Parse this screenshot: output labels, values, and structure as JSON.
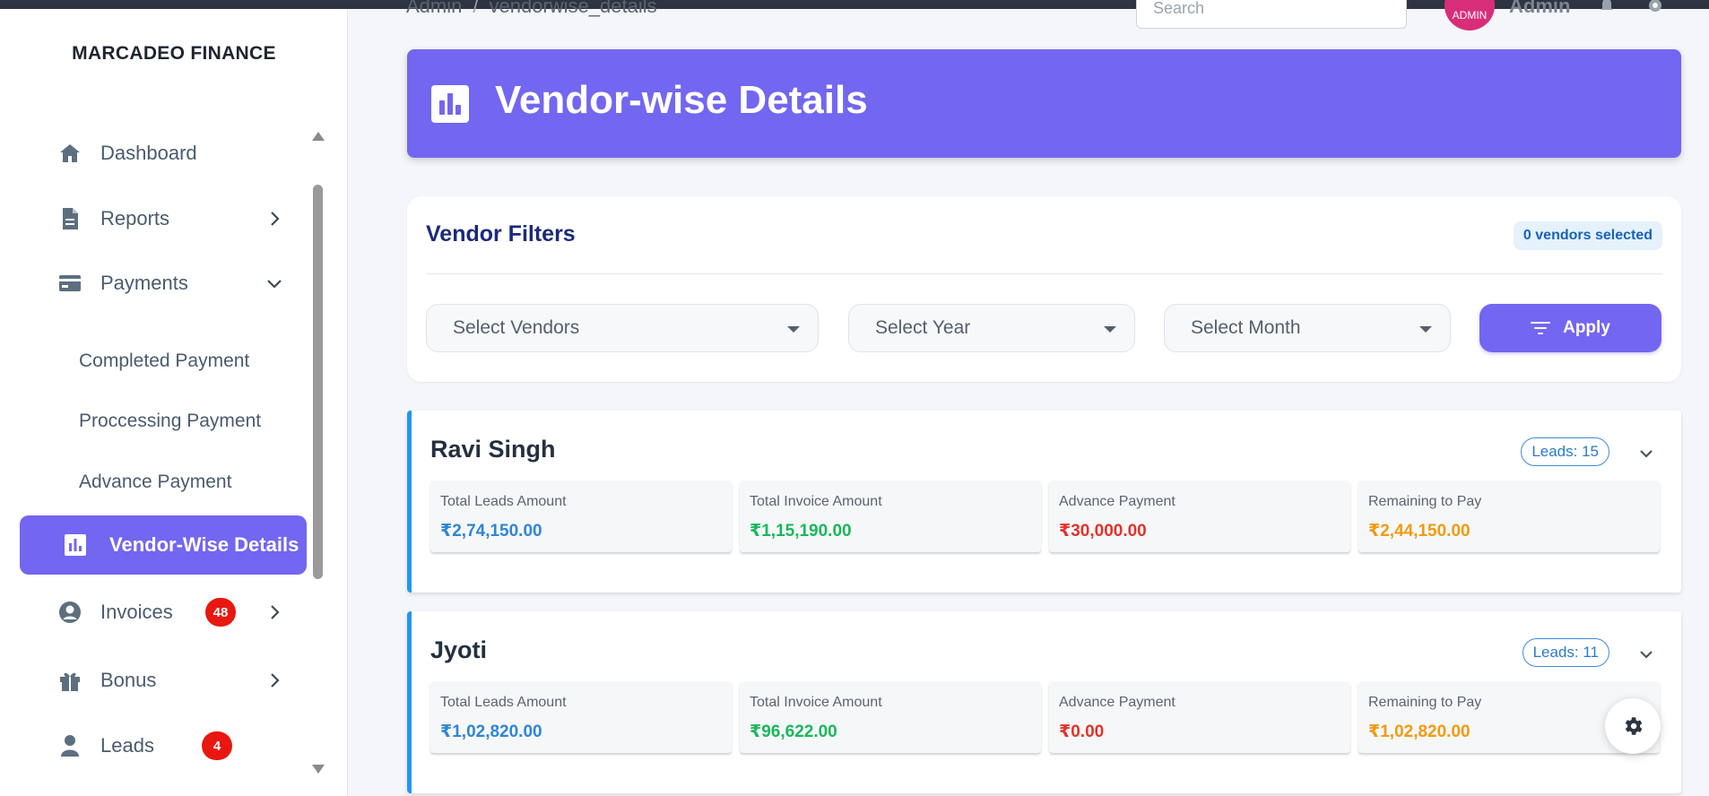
{
  "sidebar": {
    "brand": "MARCADEO FINANCE",
    "items": [
      {
        "label": "Dashboard"
      },
      {
        "label": "Reports"
      },
      {
        "label": "Payments"
      },
      {
        "label": "Vendor-Wise Details"
      },
      {
        "label": "Invoices",
        "badge": "48"
      },
      {
        "label": "Bonus"
      },
      {
        "label": "Leads",
        "badge": "4"
      }
    ],
    "payments_sub": [
      "Completed Payment",
      "Proccessing Payment",
      "Advance Payment"
    ]
  },
  "topbar": {
    "crumb_root": "Admin",
    "crumb_sep": "/",
    "crumb_current": "vendorwise_details",
    "search_placeholder": "Search",
    "avatar_text": "ADMIN",
    "user_name": "Admin"
  },
  "header": {
    "title": "Vendor-wise Details"
  },
  "filters": {
    "title": "Vendor Filters",
    "selected_badge": "0 vendors selected",
    "vendors_placeholder": "Select Vendors",
    "year_placeholder": "Select Year",
    "month_placeholder": "Select Month",
    "apply_label": "Apply"
  },
  "stat_labels": {
    "total_leads": "Total Leads Amount",
    "total_invoice": "Total Invoice Amount",
    "advance": "Advance Payment",
    "remaining": "Remaining to Pay"
  },
  "vendors": [
    {
      "name": "Ravi Singh",
      "leads": "Leads: 15",
      "total_leads_amount": "₹2,74,150.00",
      "total_invoice_amount": "₹1,15,190.00",
      "advance_payment": "₹30,000.00",
      "remaining_to_pay": "₹2,44,150.00"
    },
    {
      "name": "Jyoti",
      "leads": "Leads: 11",
      "total_leads_amount": "₹1,02,820.00",
      "total_invoice_amount": "₹96,622.00",
      "advance_payment": "₹0.00",
      "remaining_to_pay": "₹1,02,820.00"
    }
  ],
  "colors": {
    "accent": "#7366f0",
    "blue_value": "#2e86d4",
    "green_value": "#18b85a",
    "red_value": "#e3322a",
    "orange_value": "#f29a0e",
    "vendor_border": "#2196f3"
  }
}
